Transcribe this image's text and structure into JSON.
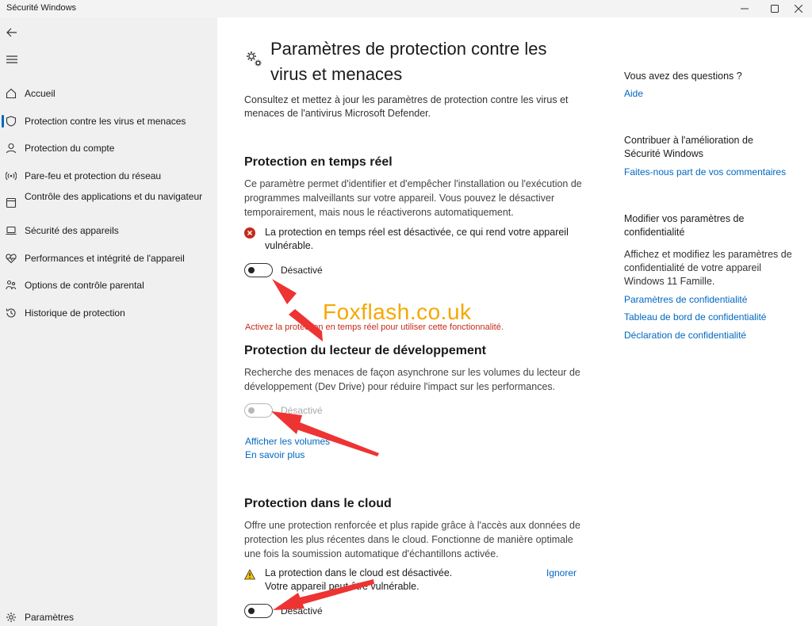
{
  "window": {
    "title": "Sécurité Windows"
  },
  "sidebar": {
    "items": [
      {
        "label": "Accueil",
        "icon": "home-icon"
      },
      {
        "label": "Protection contre les virus et menaces",
        "icon": "shield-icon",
        "active": true
      },
      {
        "label": "Protection du compte",
        "icon": "person-icon"
      },
      {
        "label": "Pare-feu et protection du réseau",
        "icon": "wifi-signal-icon"
      },
      {
        "label": "Contrôle des applications et du navigateur",
        "icon": "app-window-icon"
      },
      {
        "label": "Sécurité des appareils",
        "icon": "laptop-icon"
      },
      {
        "label": "Performances et intégrité de l'appareil",
        "icon": "heart-pulse-icon"
      },
      {
        "label": "Options de contrôle parental",
        "icon": "family-icon"
      },
      {
        "label": "Historique de protection",
        "icon": "history-icon"
      }
    ],
    "settings_label": "Paramètres"
  },
  "main": {
    "title": "Paramètres de protection contre les virus et menaces",
    "description": "Consultez et mettez à jour les paramètres de protection contre les virus et menaces de l'antivirus Microsoft Defender.",
    "realtime": {
      "title": "Protection en temps réel",
      "description": "Ce paramètre permet d'identifier et d'empêcher l'installation ou l'exécution de programmes malveillants sur votre appareil. Vous pouvez le désactiver temporairement, mais nous le réactiverons automatiquement.",
      "alert": "La protection en temps réel est désactivée, ce qui rend votre appareil vulnérable.",
      "toggle_label": "Désactivé",
      "error": "Activez la protection en temps réel pour utiliser cette fonctionnalité."
    },
    "devdrive": {
      "title": "Protection du lecteur de développement",
      "description": "Recherche des menaces de façon asynchrone sur les volumes du lecteur de développement (Dev Drive) pour réduire l'impact sur les performances.",
      "toggle_label": "Désactivé",
      "link_volumes": "Afficher les volumes",
      "link_learn": "En savoir plus"
    },
    "cloud": {
      "title": "Protection dans le cloud",
      "description": "Offre une protection renforcée et plus rapide grâce à l'accès aux données de protection les plus récentes dans le cloud. Fonctionne de manière optimale une fois la soumission automatique d'échantillons activée.",
      "alert": "La protection dans le cloud est désactivée. Votre appareil peut être vulnérable.",
      "ignore_label": "Ignorer",
      "toggle_label": "Désactivé"
    }
  },
  "aside": {
    "questions_heading": "Vous avez des questions ?",
    "help_link": "Aide",
    "contribute_heading": "Contribuer à l'amélioration de Sécurité Windows",
    "feedback_link": "Faites-nous part de vos commentaires",
    "privacy_heading": "Modifier vos paramètres de confidentialité",
    "privacy_text": "Affichez et modifiez les paramètres de confidentialité de votre appareil Windows 11 Famille.",
    "privacy_links": [
      "Paramètres de confidentialité",
      "Tableau de bord de confidentialité",
      "Déclaration de confidentialité"
    ]
  },
  "watermark": "Foxflash.co.uk",
  "colors": {
    "accent": "#0067c0",
    "error": "#c42b1c",
    "warning": "#f2c300",
    "annotation_arrow": "#ee3333",
    "watermark": "#f5a800"
  }
}
